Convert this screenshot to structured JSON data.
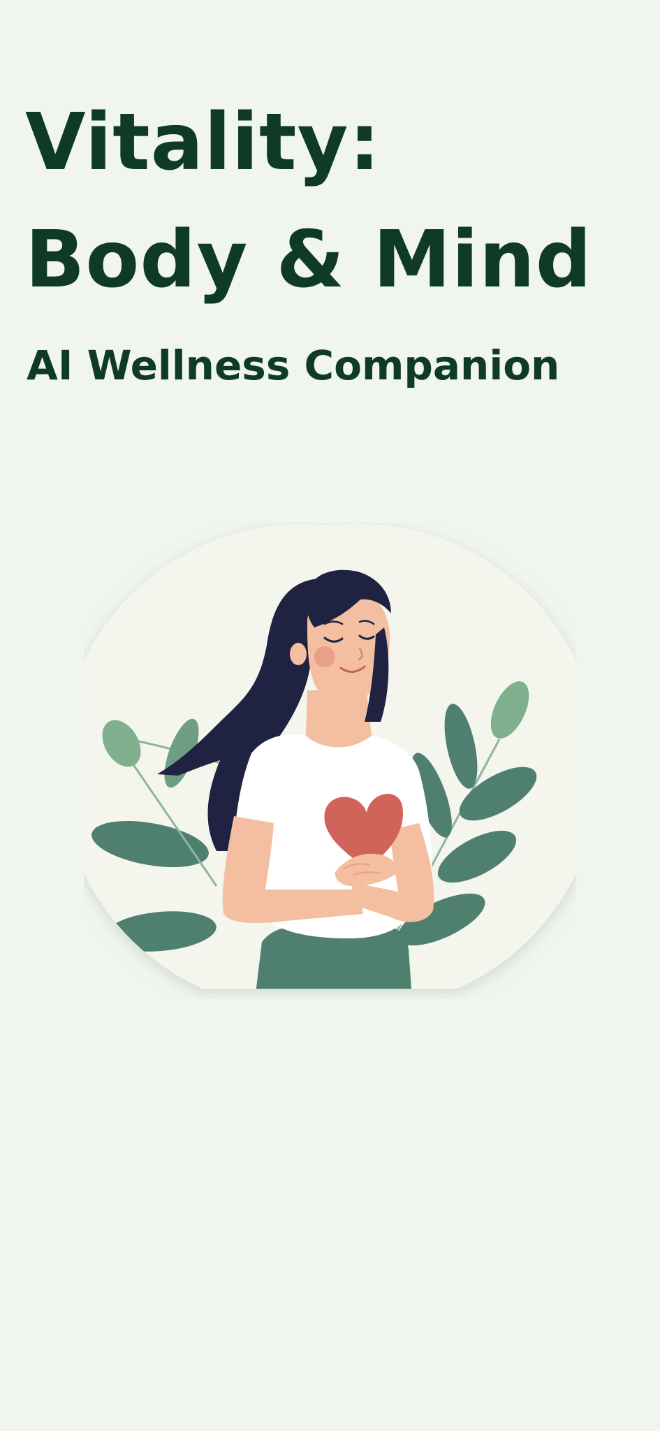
{
  "hero": {
    "title_line_1": "Vitality:",
    "title_line_2": "Body & Mind",
    "subtitle": "AI Wellness Companion"
  },
  "illustration": {
    "icon": "woman-hugging-heart-illustration"
  },
  "colors": {
    "background": "#f0f5ee",
    "title": "#0f3b26",
    "circle": "#f4f6ee",
    "leaf_dark": "#4f7f6f",
    "leaf_light": "#7eb08d",
    "hair": "#1f2240",
    "skin": "#f4bfa0",
    "heart": "#d2635a",
    "shirt": "#ffffff"
  }
}
